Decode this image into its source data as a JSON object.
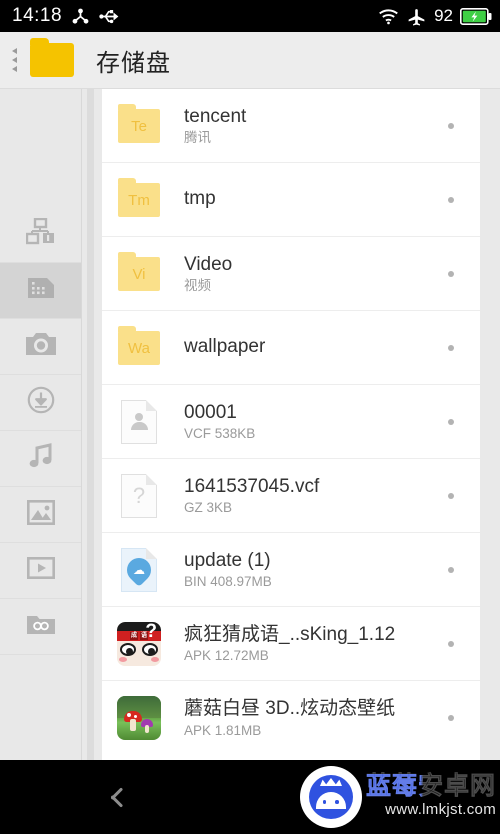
{
  "statusbar": {
    "time": "14:18",
    "left_icons": [
      "share-nodes-icon",
      "usb-icon"
    ],
    "right_icons": [
      "wifi-icon",
      "airplane-icon"
    ],
    "battery_level": "92",
    "battery_state": "charging"
  },
  "header": {
    "title": "存储盘",
    "folder_icon": "folder-icon",
    "breadcrumb_arrows": 3
  },
  "sidebar": {
    "items": [
      {
        "name": "sidebar-item-categories",
        "icon": "apps-grid-icon",
        "selected": false
      },
      {
        "name": "sidebar-item-sdcard",
        "icon": "sdcard-icon",
        "selected": true
      },
      {
        "name": "sidebar-item-camera",
        "icon": "camera-icon",
        "selected": false
      },
      {
        "name": "sidebar-item-downloads",
        "icon": "download-circle-icon",
        "selected": false
      },
      {
        "name": "sidebar-item-music",
        "icon": "music-note-icon",
        "selected": false
      },
      {
        "name": "sidebar-item-pictures",
        "icon": "image-icon",
        "selected": false
      },
      {
        "name": "sidebar-item-videos",
        "icon": "video-play-icon",
        "selected": false
      },
      {
        "name": "sidebar-item-documents",
        "icon": "folder-glasses-icon",
        "selected": false
      }
    ]
  },
  "file_list": {
    "rows": [
      {
        "icon_type": "folder",
        "badge": "Te",
        "title": "tencent",
        "subtitle": "腾讯"
      },
      {
        "icon_type": "folder",
        "badge": "Tm",
        "title": "tmp",
        "subtitle": ""
      },
      {
        "icon_type": "folder",
        "badge": "Vi",
        "title": "Video",
        "subtitle": "视频"
      },
      {
        "icon_type": "folder",
        "badge": "Wa",
        "title": "wallpaper",
        "subtitle": ""
      },
      {
        "icon_type": "contact-doc",
        "badge": "",
        "title": "00001",
        "subtitle": "VCF 538KB"
      },
      {
        "icon_type": "unknown-doc",
        "badge": "?",
        "title": "1641537045.vcf",
        "subtitle": "GZ 3KB"
      },
      {
        "icon_type": "update-doc",
        "badge": "",
        "title": "update (1)",
        "subtitle": "BIN 408.97MB"
      },
      {
        "icon_type": "apk-game",
        "badge": "",
        "title": "疯狂猜成语_..sKing_1.12",
        "subtitle": "APK 12.72MB"
      },
      {
        "icon_type": "apk-wallpaper",
        "badge": "",
        "title": "蘑菇白昼 3D..炫动态壁纸",
        "subtitle": "APK 1.81MB"
      }
    ],
    "row_menu_icon": "more-dot-icon"
  },
  "navbar": {
    "back_icon": "back-chevron-icon",
    "watermark_logo": "android-robot-icon",
    "watermark_name": "蓝莓安卓网",
    "watermark_url": "www.lmkjst.com"
  },
  "colors": {
    "accent_folder": "#f5c300",
    "folder_tile": "#fae08a",
    "status_bg": "#000000",
    "header_bg": "#ededed",
    "sidebar_bg": "#e8e8e8",
    "sidebar_selected_bg": "#d4d4d4",
    "list_bg": "#ffffff",
    "battery_green": "#3fcf45",
    "watermark_blue": "#2f52e0"
  }
}
